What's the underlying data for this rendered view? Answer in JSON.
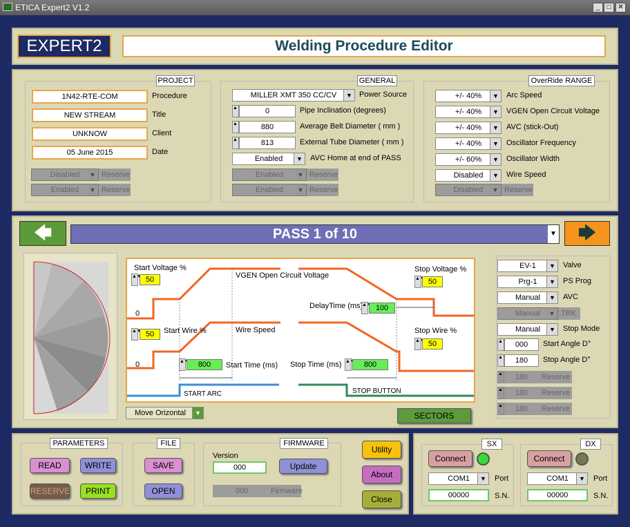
{
  "window": {
    "title": "ETICA Expert2 V1.2",
    "min": "_",
    "max": "□",
    "close": "✕"
  },
  "header": {
    "logo": "EXPERT2",
    "title": "Welding Procedure Editor"
  },
  "project": {
    "title": "PROJECT",
    "fields": [
      {
        "value": "1N42-RTE-COM",
        "label": "Procedure"
      },
      {
        "value": "NEW STREAM",
        "label": "Title"
      },
      {
        "value": "UNKNOW",
        "label": "Client"
      },
      {
        "value": "05  June 2015",
        "label": "Date"
      }
    ],
    "disabled": [
      {
        "value": "Disabled",
        "label": "Reserve"
      },
      {
        "value": "Enabled",
        "label": "Reserve"
      }
    ]
  },
  "general": {
    "title": "GENERAL",
    "power_source": {
      "value": "MILLER  XMT 350 CC/CV",
      "label": "Power Source"
    },
    "spins": [
      {
        "value": "0",
        "label": "Pipe Inclination (degrees)"
      },
      {
        "value": "880",
        "label": "Average Belt Diameter ( mm )"
      },
      {
        "value": "813",
        "label": "External Tube Diameter ( mm )"
      }
    ],
    "avc_home": {
      "value": "Enabled",
      "label": "AVC Home at end of PASS"
    },
    "disabled": [
      {
        "value": "Enabled",
        "label": "Reserve"
      },
      {
        "value": "Enabled",
        "label": "Reserve"
      }
    ]
  },
  "override": {
    "title": "OverRide RANGE",
    "items": [
      {
        "value": "+/- 40%",
        "label": "Arc Speed"
      },
      {
        "value": "+/- 40%",
        "label": "VGEN Open Circuit Voltage"
      },
      {
        "value": "+/- 40%",
        "label": "AVC (stick-Out)"
      },
      {
        "value": "+/- 40%",
        "label": "Oscillator Frequency"
      },
      {
        "value": "+/- 60%",
        "label": "Oscillator Width"
      },
      {
        "value": "Disabled",
        "label": "Wire Speed"
      }
    ],
    "disabled": {
      "value": "Disabled",
      "label": "Reserve"
    }
  },
  "pass": {
    "label": "PASS 1 of 10",
    "prev_icon": "arrow-left-icon",
    "next_icon": "arrow-right-icon",
    "colors": {
      "bar": "#6f6fb8",
      "prev": "#5c9a3a",
      "next": "#f7941d"
    }
  },
  "diagram": {
    "start_voltage_label": "Start Voltage %",
    "start_voltage": "50",
    "vgen_label": "VGEN Open Circuit Voltage",
    "stop_voltage_label": "Stop Voltage %",
    "stop_voltage": "50",
    "delay_label": "DelayTime (ms)",
    "delay": "100",
    "start_wire_label": "Start Wire %",
    "start_wire": "50",
    "wire_speed_label": "Wire Speed",
    "stop_wire_label": "Stop Wire %",
    "stop_wire": "50",
    "start_time": "800",
    "start_time_label": "Start Time (ms)",
    "stop_time_label": "Stop Time (ms)",
    "stop_time": "800",
    "zero1": "0",
    "zero2": "0",
    "start_arc": "START ARC",
    "stop_button": "STOP BUTTON",
    "colors": {
      "line": "#f26522",
      "arc": "#3a8fd8",
      "stop": "#2e8b57"
    }
  },
  "move": {
    "value": "Move Orizontal"
  },
  "sectors": {
    "label": "SECTORS"
  },
  "right": {
    "combos": [
      {
        "value": "EV-1",
        "label": "Valve"
      },
      {
        "value": "Prg-1",
        "label": "PS Prog"
      },
      {
        "value": "Manual",
        "label": "AVC"
      }
    ],
    "trk": {
      "value": "Manual",
      "label": "TRK"
    },
    "stop_mode": {
      "value": "Manual",
      "label": "Stop Mode"
    },
    "spins": [
      {
        "value": "000",
        "label": "Start Angle D°"
      },
      {
        "value": "180",
        "label": "Stop Angle D°"
      }
    ],
    "reserves": [
      {
        "value": "180",
        "label": "Reserve"
      },
      {
        "value": "180",
        "label": "Reserve"
      },
      {
        "value": "180",
        "label": "Reserve"
      }
    ]
  },
  "parameters": {
    "title": "PARAMETERS",
    "read": "READ",
    "write": "WRITE",
    "reserve": "RESERVE",
    "print": "PRINT"
  },
  "file": {
    "title": "FILE",
    "save": "SAVE",
    "open": "OPEN"
  },
  "firmware": {
    "title": "FIRMWARE",
    "version_label": "Version",
    "version": "000",
    "update": "Update",
    "fw_value": "000",
    "fw_label": "Firmware"
  },
  "misc": {
    "utility": "Utility",
    "about": "About",
    "close": "Close"
  },
  "sx": {
    "title": "SX",
    "connect": "Connect",
    "port": "COM1",
    "port_label": "Port",
    "sn": "00000",
    "sn_label": "S.N.",
    "led": "#33dd33"
  },
  "dx": {
    "title": "DX",
    "connect": "Connect",
    "port": "COM1",
    "port_label": "Port",
    "sn": "00000",
    "sn_label": "S.N.",
    "led": "#777755"
  }
}
